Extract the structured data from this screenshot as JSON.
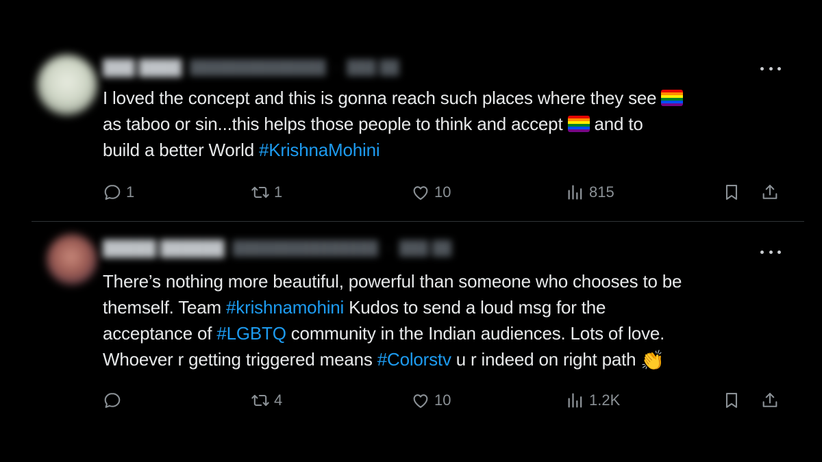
{
  "tweets": [
    {
      "text_parts": {
        "l1": "I loved the concept and this is gonna reach such places where they see ",
        "l2a": "as  taboo  or  sin...this  helps those  people to think and accept ",
        "l2b": " and  to",
        "l3": "build a  better World  ",
        "hashtag1": "#KrishnaMohini"
      },
      "emoji": {
        "flag": "rainbow-flag"
      },
      "stats": {
        "replies": "1",
        "retweets": "1",
        "likes": "10",
        "views": "815"
      }
    },
    {
      "text_parts": {
        "l1": "There’s nothing more beautiful, powerful than someone who chooses to be",
        "l2a": "themself. Team ",
        "hashtag1": "#krishnamohini",
        "l2b": " Kudos to send a loud msg for the",
        "l3a": "acceptance of  ",
        "hashtag2": "#LGBTQ",
        "l3b": " community in the Indian audiences. Lots of love.",
        "l4a": "Whoever r getting triggered means ",
        "hashtag3": "#Colorstv",
        "l4b": " u r indeed on right path ",
        "clap": "👏"
      },
      "stats": {
        "replies": "",
        "retweets": "4",
        "likes": "10",
        "views": "1.2K"
      }
    }
  ],
  "colors": {
    "background": "#000000",
    "text": "#e7e9ea",
    "hashtag": "#1d9bf0",
    "muted": "#8b9196",
    "divider": "#2f3336"
  },
  "icons": [
    "reply-icon",
    "retweet-icon",
    "like-icon",
    "views-icon",
    "bookmark-icon",
    "share-icon",
    "more-icon"
  ]
}
